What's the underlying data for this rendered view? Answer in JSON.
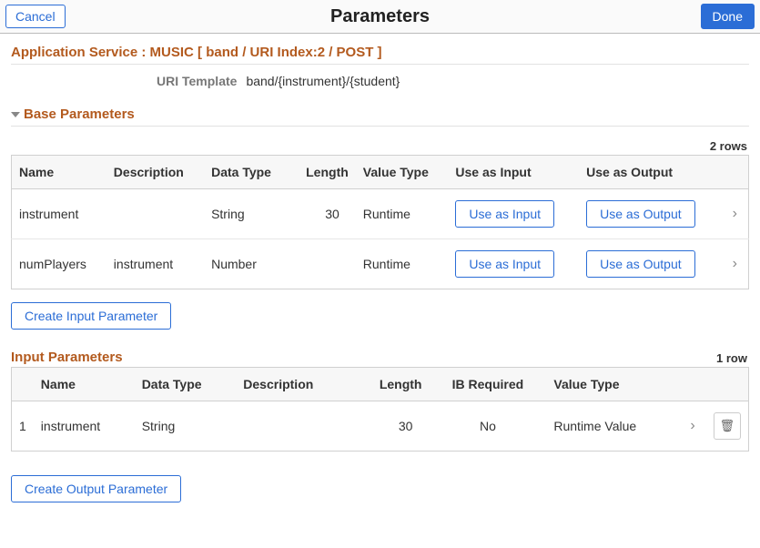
{
  "topbar": {
    "cancel": "Cancel",
    "title": "Parameters",
    "done": "Done"
  },
  "appService": "Application Service : MUSIC [ band / URI Index:2 / POST ]",
  "uriTemplate": {
    "label": "URI Template",
    "value": "band/{instrument}/{student}"
  },
  "baseParams": {
    "header": "Base Parameters",
    "rowcount": "2 rows",
    "cols": {
      "name": "Name",
      "desc": "Description",
      "dtype": "Data Type",
      "len": "Length",
      "vtype": "Value Type",
      "uin": "Use as Input",
      "uout": "Use as Output"
    },
    "rows": [
      {
        "name": "instrument",
        "desc": "",
        "dtype": "String",
        "len": "30",
        "vtype": "Runtime",
        "uin": "Use as Input",
        "uout": "Use as Output"
      },
      {
        "name": "numPlayers",
        "desc": "instrument",
        "dtype": "Number",
        "len": "",
        "vtype": "Runtime",
        "uin": "Use as Input",
        "uout": "Use as Output"
      }
    ]
  },
  "createInput": "Create Input Parameter",
  "inputParams": {
    "header": "Input Parameters",
    "rowcount": "1 row",
    "cols": {
      "idx": "",
      "name": "Name",
      "dtype": "Data Type",
      "desc": "Description",
      "len": "Length",
      "ibreq": "IB Required",
      "vtype": "Value Type"
    },
    "rows": [
      {
        "idx": "1",
        "name": "instrument",
        "dtype": "String",
        "desc": "",
        "len": "30",
        "ibreq": "No",
        "vtype": "Runtime Value"
      }
    ]
  },
  "createOutput": "Create Output Parameter"
}
